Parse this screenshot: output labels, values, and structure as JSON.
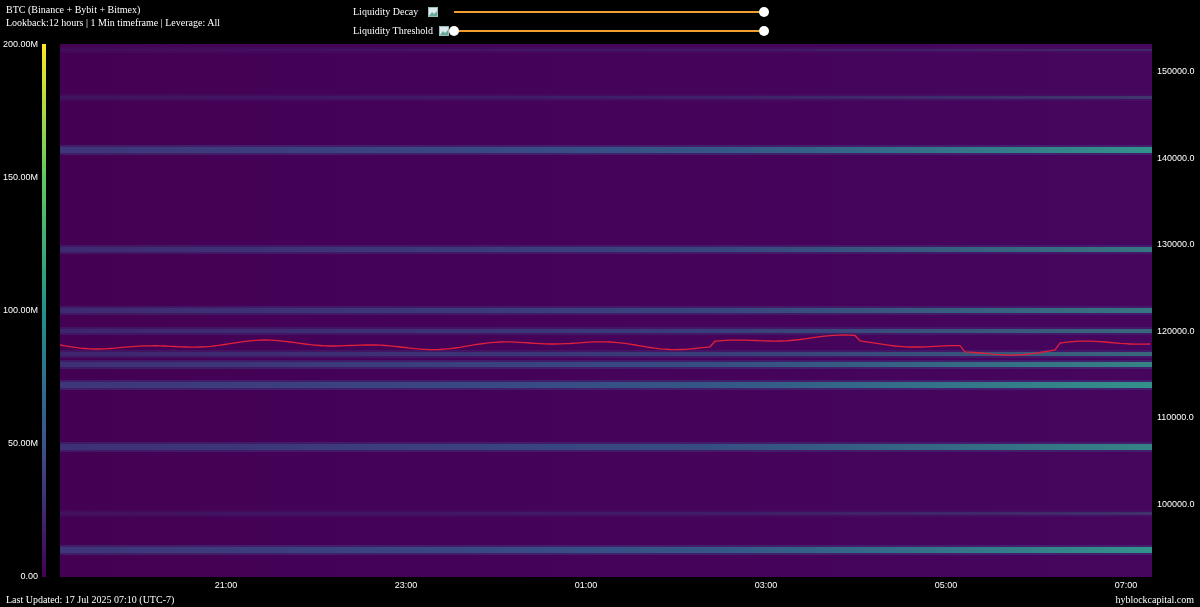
{
  "header": {
    "title": "BTC (Binance + Bybit + Bitmex)",
    "subtitle": "Lookback:12 hours | 1 Min timeframe | Leverage: All"
  },
  "sliders": [
    {
      "label": "Liquidity Decay",
      "thumbs": [
        {
          "level": 1
        }
      ]
    },
    {
      "label": "Liquidity Threshold",
      "thumbs": [
        {
          "level": 0
        },
        {
          "level": 1
        }
      ]
    }
  ],
  "colorbar": {
    "ticks": [
      "200.00M",
      "150.00M",
      "100.00M",
      "50.00M",
      "0.00"
    ]
  },
  "price_axis": {
    "ticks": [
      "150000.0",
      "140000.0",
      "130000.0",
      "120000.0",
      "110000.0",
      "100000.0"
    ]
  },
  "time_axis": {
    "ticks": [
      "21:00",
      "23:00",
      "01:00",
      "03:00",
      "05:00",
      "07:00"
    ]
  },
  "footer": {
    "last_updated": "Last Updated: 17 Jul 2025 07:10 (UTC-7)",
    "source": "hyblockcapital.com"
  }
}
